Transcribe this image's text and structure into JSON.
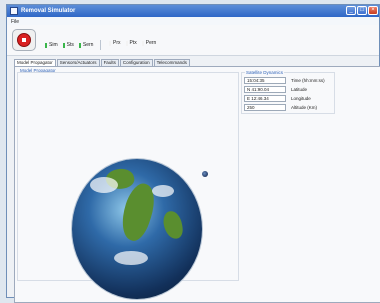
{
  "window": {
    "title": "Removal Simulator"
  },
  "menu": {
    "items": [
      "File"
    ]
  },
  "toolbar": {
    "groups": [
      [
        {
          "label": "Sim",
          "color": "#39b64a"
        },
        {
          "label": "Sts",
          "color": "#39b64a"
        },
        {
          "label": "Sern",
          "color": "#39b64a"
        }
      ],
      [
        {
          "label": "Prx",
          "color": "#f3f3f3"
        },
        {
          "label": "Ptx",
          "color": "#f3f3f3"
        },
        {
          "label": "Pern",
          "color": "#f3f3f3"
        }
      ]
    ]
  },
  "tabs": [
    "Model Propagator",
    "Sensors/Actuators",
    "Faults",
    "Configuration",
    "Telecommands"
  ],
  "active_tab": "Model Propagator",
  "panel": {
    "label": "Model Propagator",
    "satellite": {
      "title": "Satellite Dynamics",
      "fields": [
        {
          "value": "15:04:35",
          "label": "Time (hh:mm:ss)"
        },
        {
          "value": "N 41:90.04",
          "label": "Latitude"
        },
        {
          "value": "E 12:46.34",
          "label": "Longitude"
        },
        {
          "value": "250",
          "label": "Altitude (Km)"
        }
      ]
    }
  }
}
